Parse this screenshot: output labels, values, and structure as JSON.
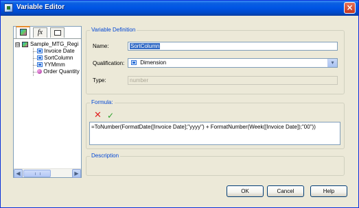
{
  "window": {
    "title": "Variable Editor",
    "close_glyph": "×"
  },
  "tabs": {
    "objects_icon": "objects-icon",
    "functions_label": "fx",
    "operators_icon": "operators-icon"
  },
  "tree": {
    "root": {
      "label": "Sample_MTG_Regi",
      "icon": "universe-icon",
      "expander": "⊟"
    },
    "items": [
      {
        "label": "Invoice Date",
        "icon": "dimension-icon"
      },
      {
        "label": "SortColumn",
        "icon": "dimension-icon"
      },
      {
        "label": "YYMmm",
        "icon": "dimension-icon"
      },
      {
        "label": "Order Quantity",
        "icon": "measure-icon"
      }
    ]
  },
  "scrollbar": {
    "left_arrow": "◀",
    "right_arrow": "▶"
  },
  "variable_definition": {
    "legend": "Variable Definition",
    "name_label": "Name:",
    "name_value": "SortColumn",
    "qualification_label": "Qualification:",
    "qualification_value": "Dimension",
    "type_label": "Type:",
    "type_value": "number",
    "combo_arrow": "▾"
  },
  "formula": {
    "legend": "Formula:",
    "cancel_glyph": "✕",
    "validate_glyph": "✓",
    "text": "=ToNumber(FormatDate([Invoice Date];\"yyyy\") + FormatNumber(Week([Invoice Date]);\"00\"))"
  },
  "description": {
    "legend": "Description"
  },
  "buttons": {
    "ok": "OK",
    "cancel": "Cancel",
    "help": "Help"
  },
  "colors": {
    "titlebar": "#0055e5",
    "legend_text": "#0046d5",
    "selection": "#316ac5",
    "cancel_icon": "#e02020",
    "validate_icon": "#2aa02a"
  }
}
